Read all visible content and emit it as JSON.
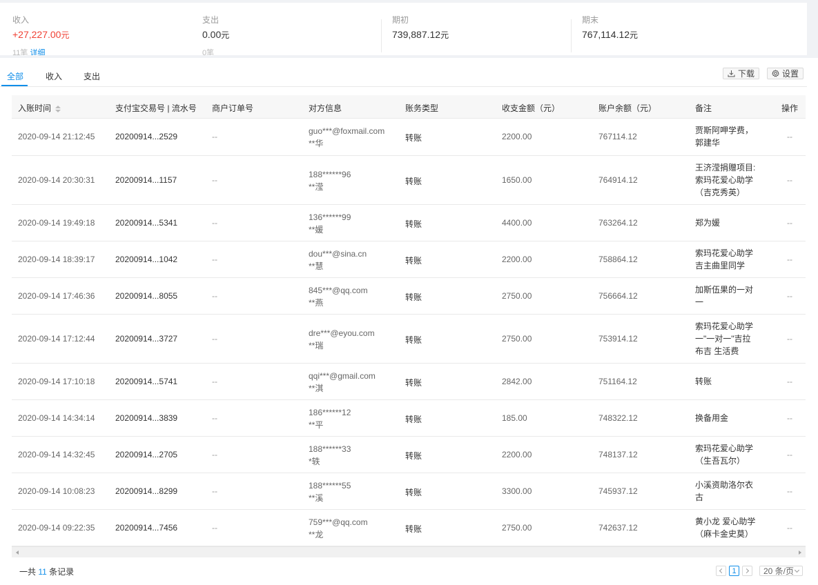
{
  "summary": {
    "income": {
      "label": "收入",
      "value": "+27,227.00",
      "unit": "元",
      "count": "11笔",
      "detail_link": "详细"
    },
    "expense": {
      "label": "支出",
      "value": "0.00",
      "unit": "元",
      "count": "0笔"
    },
    "opening": {
      "label": "期初",
      "value": "739,887.12",
      "unit": "元"
    },
    "closing": {
      "label": "期末",
      "value": "767,114.12",
      "unit": "元"
    }
  },
  "tabs": [
    {
      "label": "全部",
      "active": true
    },
    {
      "label": "收入"
    },
    {
      "label": "支出"
    }
  ],
  "toolbar": {
    "download_label": "下载",
    "settings_label": "设置"
  },
  "table": {
    "columns": [
      "入账时间",
      "支付宝交易号 | 流水号",
      "商户订单号",
      "对方信息",
      "账务类型",
      "收支金额（元）",
      "账户余额（元）",
      "备注",
      "操作"
    ],
    "rows": [
      {
        "time": "2020-09-14 21:12:45",
        "serial": "20200914...2529",
        "order": "--",
        "party1": "guo***@foxmail.com",
        "party2": "**华",
        "type": "转账",
        "amount": "2200.00",
        "balance": "767114.12",
        "note": [
          "贾斯阿呷学费，",
          "郭建华"
        ],
        "action": "--"
      },
      {
        "time": "2020-09-14 20:30:31",
        "serial": "20200914...1157",
        "order": "--",
        "party1": "188******96",
        "party2": "**滢",
        "type": "转账",
        "amount": "1650.00",
        "balance": "764914.12",
        "note": [
          "王济滢捐赠项目:",
          "索玛花爱心助学",
          "（吉克秀英）"
        ],
        "action": "--"
      },
      {
        "time": "2020-09-14 19:49:18",
        "serial": "20200914...5341",
        "order": "--",
        "party1": "136******99",
        "party2": "**媛",
        "type": "转账",
        "amount": "4400.00",
        "balance": "763264.12",
        "note": [
          "郑为媛"
        ],
        "action": "--"
      },
      {
        "time": "2020-09-14 18:39:17",
        "serial": "20200914...1042",
        "order": "--",
        "party1": "dou***@sina.cn",
        "party2": "**慧",
        "type": "转账",
        "amount": "2200.00",
        "balance": "758864.12",
        "note": [
          "索玛花爱心助学",
          "吉主曲里同学"
        ],
        "action": "--"
      },
      {
        "time": "2020-09-14 17:46:36",
        "serial": "20200914...8055",
        "order": "--",
        "party1": "845***@qq.com",
        "party2": "**燕",
        "type": "转账",
        "amount": "2750.00",
        "balance": "756664.12",
        "note": [
          "加斯伍果的一对",
          "一"
        ],
        "action": "--"
      },
      {
        "time": "2020-09-14 17:12:44",
        "serial": "20200914...3727",
        "order": "--",
        "party1": "dre***@eyou.com",
        "party2": "**瑞",
        "type": "转账",
        "amount": "2750.00",
        "balance": "753914.12",
        "note": [
          "索玛花爱心助学",
          "一\"一对一\"吉拉",
          "布吉 生活费"
        ],
        "action": "--"
      },
      {
        "time": "2020-09-14 17:10:18",
        "serial": "20200914...5741",
        "order": "--",
        "party1": "qqi***@gmail.com",
        "party2": "**淇",
        "type": "转账",
        "amount": "2842.00",
        "balance": "751164.12",
        "note": [
          "转账"
        ],
        "action": "--"
      },
      {
        "time": "2020-09-14 14:34:14",
        "serial": "20200914...3839",
        "order": "--",
        "party1": "186******12",
        "party2": "**平",
        "type": "转账",
        "amount": "185.00",
        "balance": "748322.12",
        "note": [
          "换备用金"
        ],
        "action": "--"
      },
      {
        "time": "2020-09-14 14:32:45",
        "serial": "20200914...2705",
        "order": "--",
        "party1": "188******33",
        "party2": "*轶",
        "type": "转账",
        "amount": "2200.00",
        "balance": "748137.12",
        "note": [
          "索玛花爱心助学",
          "（生吾瓦尔）"
        ],
        "action": "--"
      },
      {
        "time": "2020-09-14 10:08:23",
        "serial": "20200914...8299",
        "order": "--",
        "party1": "188******55",
        "party2": "**溪",
        "type": "转账",
        "amount": "3300.00",
        "balance": "745937.12",
        "note": [
          "小溪资助洛尔衣",
          "古"
        ],
        "action": "--"
      },
      {
        "time": "2020-09-14 09:22:35",
        "serial": "20200914...7456",
        "order": "--",
        "party1": "759***@qq.com",
        "party2": "**龙",
        "type": "转账",
        "amount": "2750.00",
        "balance": "742637.12",
        "note": [
          "黄小龙 爱心助学",
          "（麻卡金史莫）"
        ],
        "action": "--"
      }
    ]
  },
  "footer": {
    "total_prefix": "一共",
    "total_count": "11",
    "total_suffix": "条记录",
    "current_page": "1",
    "page_size": "20 条/页"
  }
}
